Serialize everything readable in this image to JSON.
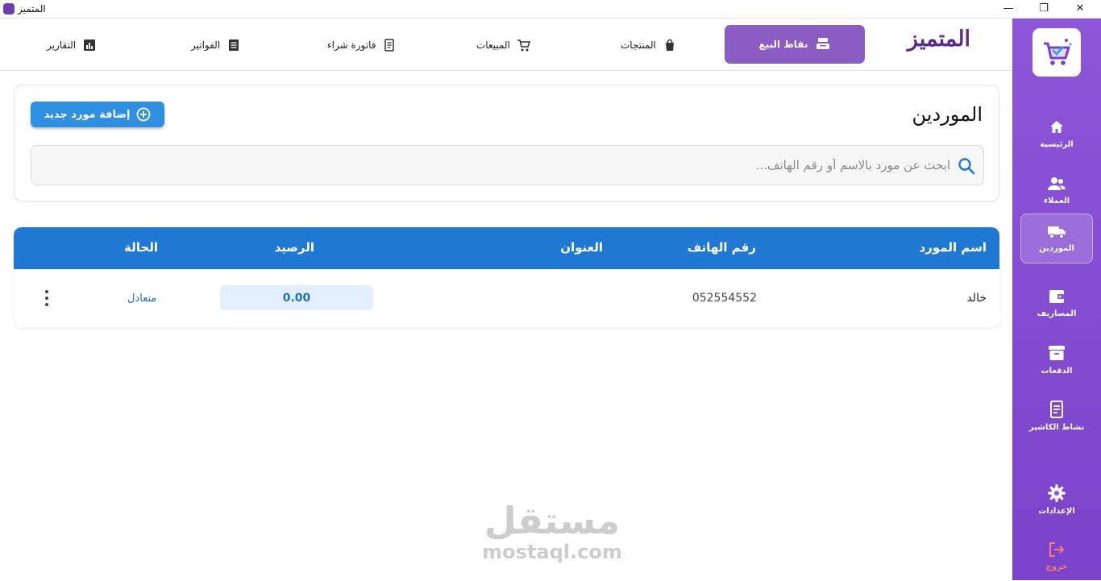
{
  "window": {
    "title": "المتميز",
    "min": "—",
    "max": "❐",
    "close": "✕"
  },
  "brand": "المتميز",
  "topnav": {
    "pos": "نقاط البيع",
    "products": "المنتجات",
    "sales": "المبيعات",
    "purchase_invoice": "فاتورة شراء",
    "invoices": "الفواتير",
    "reports": "التقارير"
  },
  "sidebar": {
    "home": "الرئيسية",
    "customers": "العملاء",
    "suppliers": "الموردين",
    "expenses": "المصاريف",
    "payments": "الدفعات",
    "cashier_activity": "نشاط الكاشير",
    "settings": "الإعدادات",
    "logout": "خروج"
  },
  "page": {
    "title": "الموردين",
    "add_button": "إضافة مورد جديد",
    "search_placeholder": "ابحث عن مورد بالاسم أو رقم الهاتف..."
  },
  "table": {
    "headers": {
      "name": "اسم المورد",
      "phone": "رقم الهاتف",
      "address": "العنوان",
      "balance": "الرصيد",
      "status": "الحالة"
    },
    "rows": [
      {
        "name": "خالد",
        "phone": "052554552",
        "address": "",
        "balance": "0.00",
        "status": "متعادل"
      }
    ]
  },
  "watermark": {
    "arabic": "مستقل",
    "latin": "mostaql.com"
  },
  "colors": {
    "sidebar": "#8d55d8",
    "pos_button": "#8a5cc4",
    "table_header": "#1f78d1",
    "add_button": "#2f8fe0",
    "status_text": "#1f6fc3",
    "logout": "#ff7a6e"
  }
}
